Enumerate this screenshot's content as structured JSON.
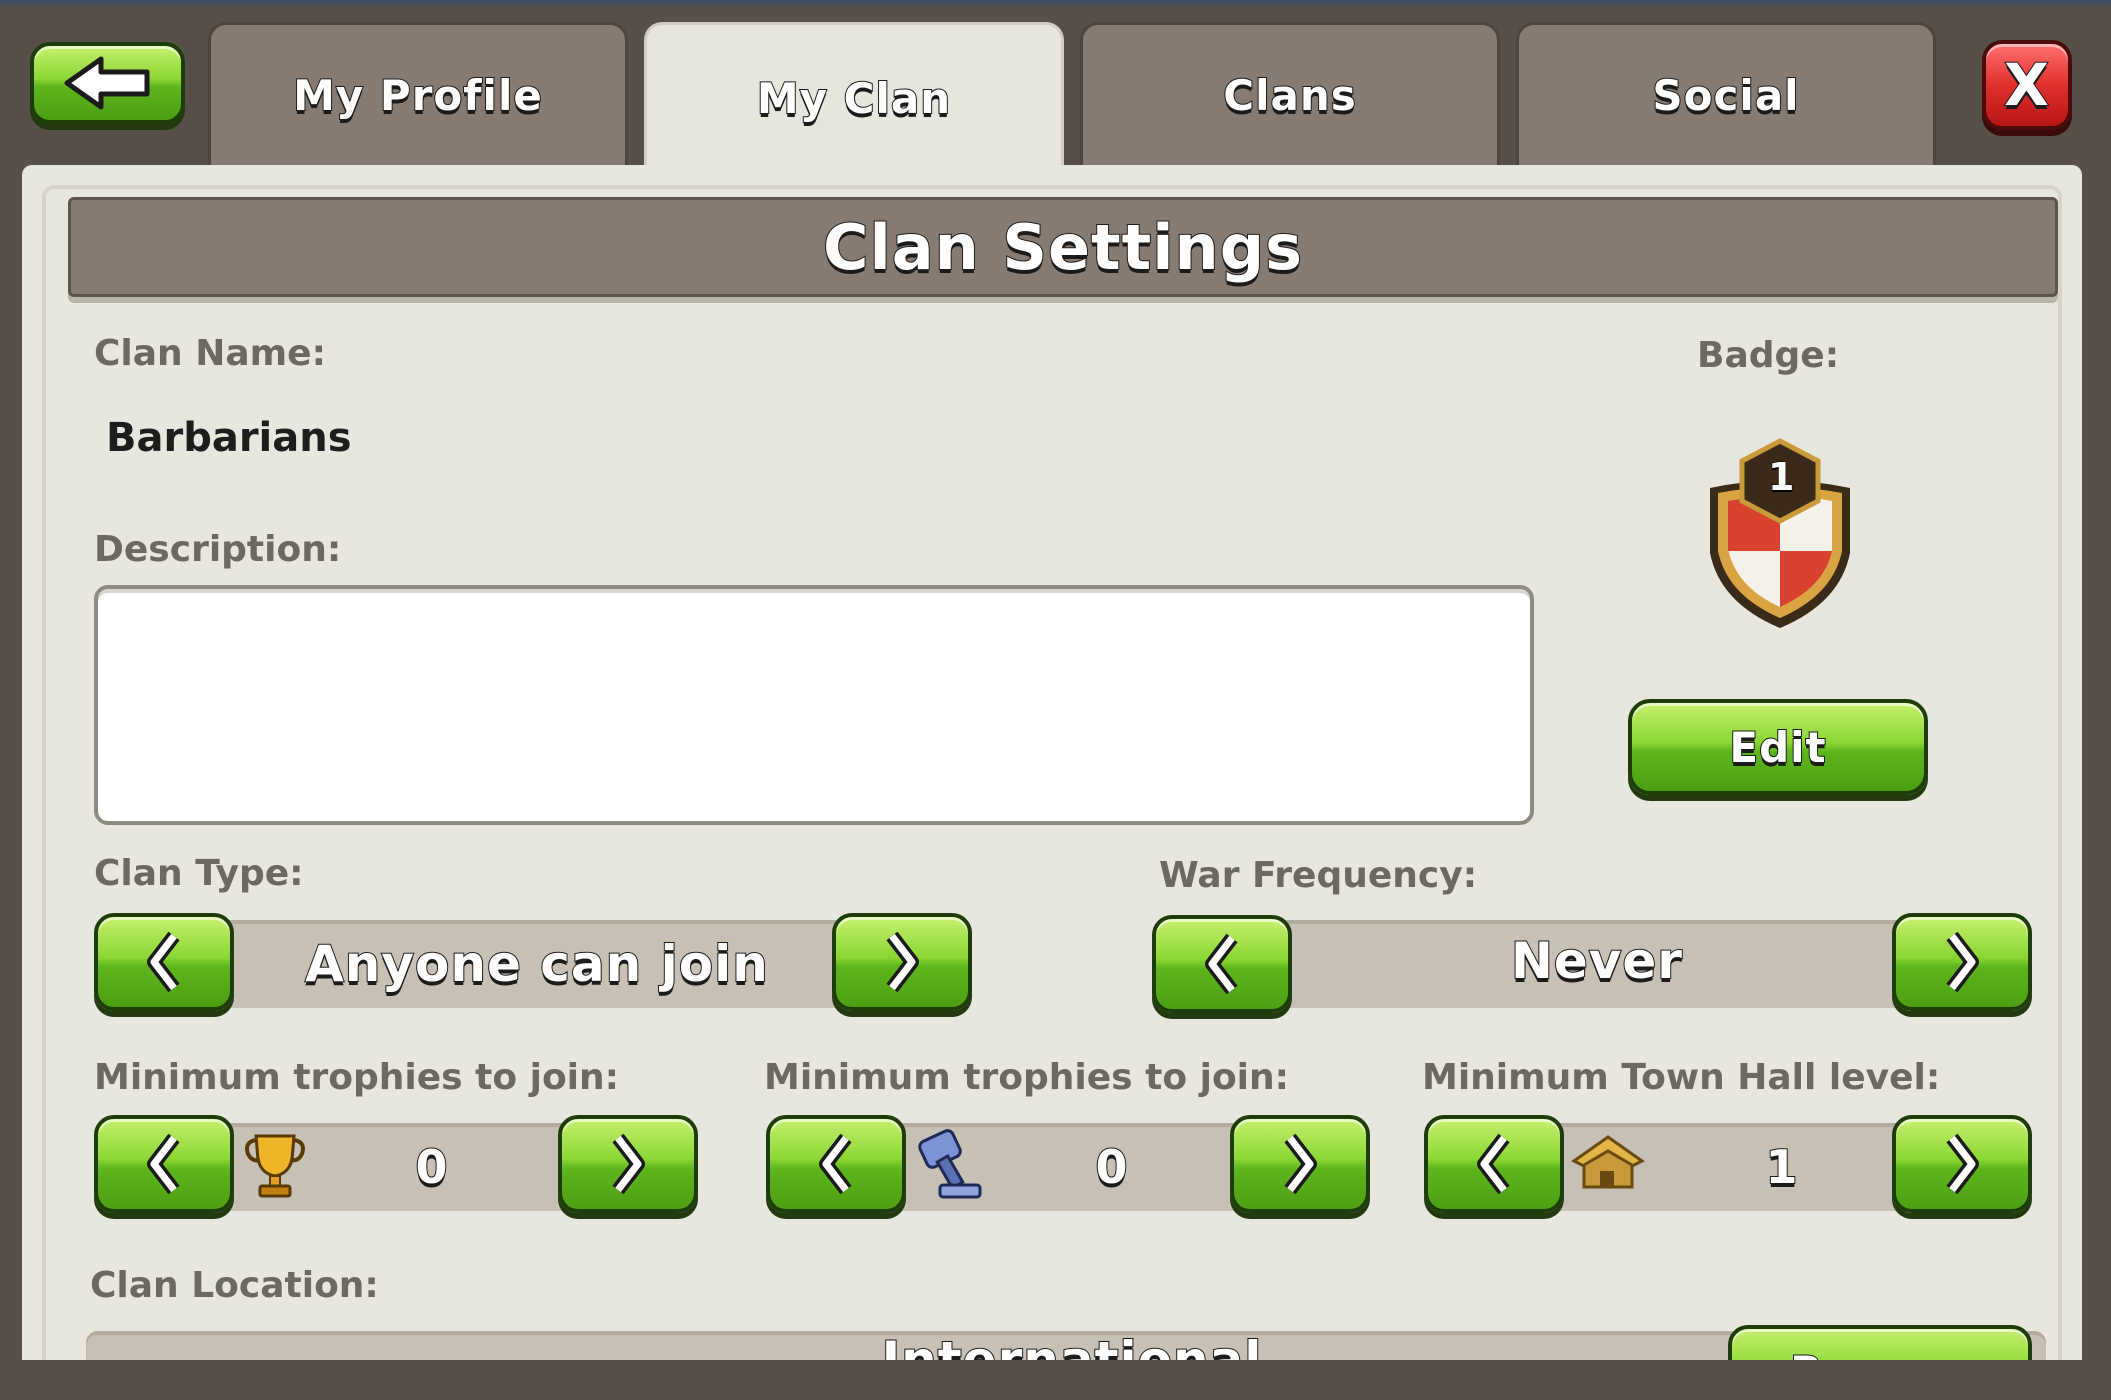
{
  "tabs": [
    {
      "label": "My Profile",
      "active": false
    },
    {
      "label": "My Clan",
      "active": true
    },
    {
      "label": "Clans",
      "active": false
    },
    {
      "label": "Social",
      "active": false
    }
  ],
  "close_label": "X",
  "panel": {
    "title": "Clan Settings",
    "clan_name_label": "Clan Name:",
    "clan_name_value": "Barbarians",
    "badge_label": "Badge:",
    "badge_level": "1",
    "edit_label": "Edit",
    "description_label": "Description:",
    "description_value": "",
    "clan_type_label": "Clan Type:",
    "clan_type_value": "Anyone can join",
    "war_frequency_label": "War Frequency:",
    "war_frequency_value": "Never",
    "min_trophies_label": "Minimum trophies to join:",
    "min_trophies_value": "0",
    "min_builder_trophies_label": "Minimum trophies to join:",
    "min_builder_trophies_value": "0",
    "min_town_hall_label": "Minimum Town Hall level:",
    "min_town_hall_value": "1",
    "clan_location_label": "Clan Location:",
    "clan_location_value": "International",
    "browse_label": "Browse"
  },
  "icons": {
    "back": "back-arrow-icon",
    "close": "close-icon",
    "trophy": "trophy-icon",
    "builder_trophy": "builder-trophy-icon",
    "town_hall": "town-hall-icon",
    "badge": "clan-badge-icon"
  },
  "colors": {
    "button_green": "#8ad633",
    "button_red": "#e0302d",
    "panel_bg": "#e8e7df",
    "header_bg": "#857b72"
  }
}
